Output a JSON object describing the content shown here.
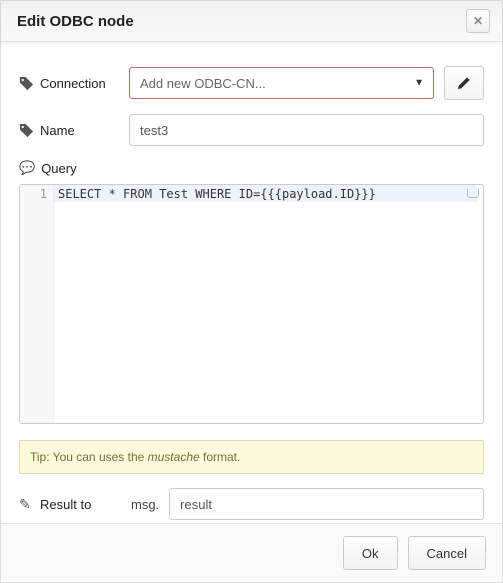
{
  "title": "Edit ODBC node",
  "fields": {
    "connection": {
      "label": "Connection",
      "selected": "Add new ODBC-CN..."
    },
    "name": {
      "label": "Name",
      "value": "test3"
    },
    "query": {
      "label": "Query",
      "value": "SELECT * FROM Test WHERE ID={{{payload.ID}}}"
    },
    "result": {
      "label": "Result to",
      "prefix": "msg.",
      "value": "result"
    }
  },
  "tip": {
    "prefix": "Tip: You can uses the ",
    "emph": "mustache",
    "suffix": " format."
  },
  "buttons": {
    "ok": "Ok",
    "cancel": "Cancel"
  },
  "editor": {
    "lineno": "1"
  }
}
